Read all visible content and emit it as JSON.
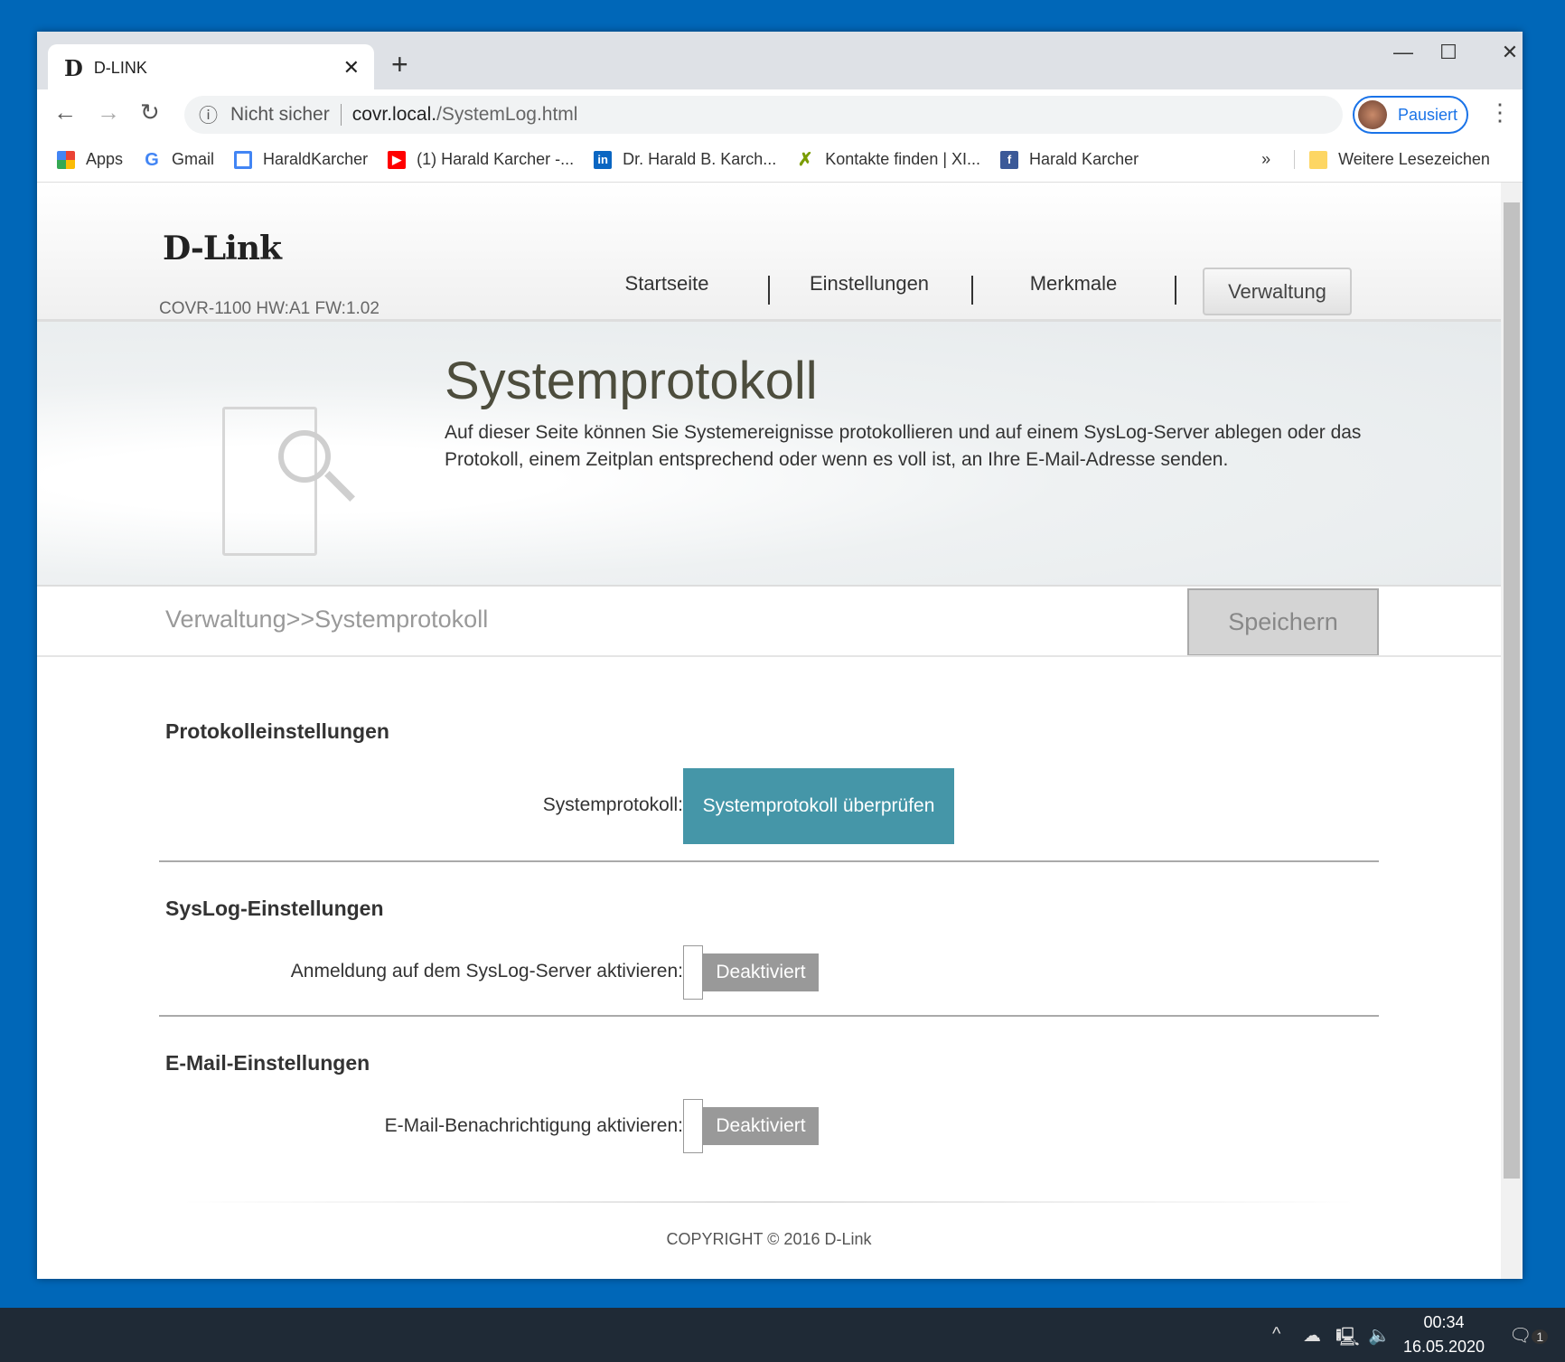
{
  "browser": {
    "tab_title": "D-LINK",
    "tab_favicon": "D",
    "omnibox": {
      "security": "Nicht sicher",
      "url_host": "covr.local.",
      "url_path": "/SystemLog.html"
    },
    "profile": "Pausiert",
    "bookmarks": [
      {
        "label": "Apps",
        "icon": "apps-grid",
        "color": "#e94235"
      },
      {
        "label": "Gmail",
        "icon": "google-g",
        "color": "#4285f4"
      },
      {
        "label": "HaraldKarcher",
        "icon": "page",
        "color": "#4285f4"
      },
      {
        "label": "(1) Harald Karcher -...",
        "icon": "youtube",
        "color": "#ff0000"
      },
      {
        "label": "Dr. Harald B. Karch...",
        "icon": "linkedin",
        "color": "#0a66c2"
      },
      {
        "label": "Kontakte finden | XI...",
        "icon": "xing",
        "color": "#b0d400"
      },
      {
        "label": "Harald Karcher",
        "icon": "facebook",
        "color": "#3b5998"
      }
    ],
    "bookmarks_more": "»",
    "other_bookmarks": "Weitere Lesezeichen"
  },
  "header": {
    "logo": "D-Link",
    "model": "COVR-1100 HW:A1 FW:1.02",
    "nav": [
      "Startseite",
      "Einstellungen",
      "Merkmale",
      "Verwaltung"
    ]
  },
  "banner": {
    "title": "Systemprotokoll",
    "description": "Auf dieser Seite können Sie Systemereignisse protokollieren und auf einem SysLog-Server ablegen oder das Protokoll, einem Zeitplan entsprechend oder wenn es voll ist, an Ihre E-Mail-Adresse senden."
  },
  "breadcrumb": "Verwaltung>>Systemprotokoll",
  "save": "Speichern",
  "sections": {
    "log": {
      "title": "Protokolleinstellungen",
      "label": "Systemprotokoll:",
      "button": "Systemprotokoll überprüfen"
    },
    "syslog": {
      "title": "SysLog-Einstellungen",
      "label": "Anmeldung auf dem SysLog-Server aktivieren:",
      "state": "Deaktiviert"
    },
    "email": {
      "title": "E-Mail-Einstellungen",
      "label": "E-Mail-Benachrichtigung aktivieren:",
      "state": "Deaktiviert"
    }
  },
  "footer": "COPYRIGHT © 2016 D-Link",
  "taskbar": {
    "time": "00:34",
    "date": "16.05.2020",
    "notifications": "1"
  },
  "colors": {
    "accent": "#4596a8",
    "desktop": "#0067b8"
  }
}
